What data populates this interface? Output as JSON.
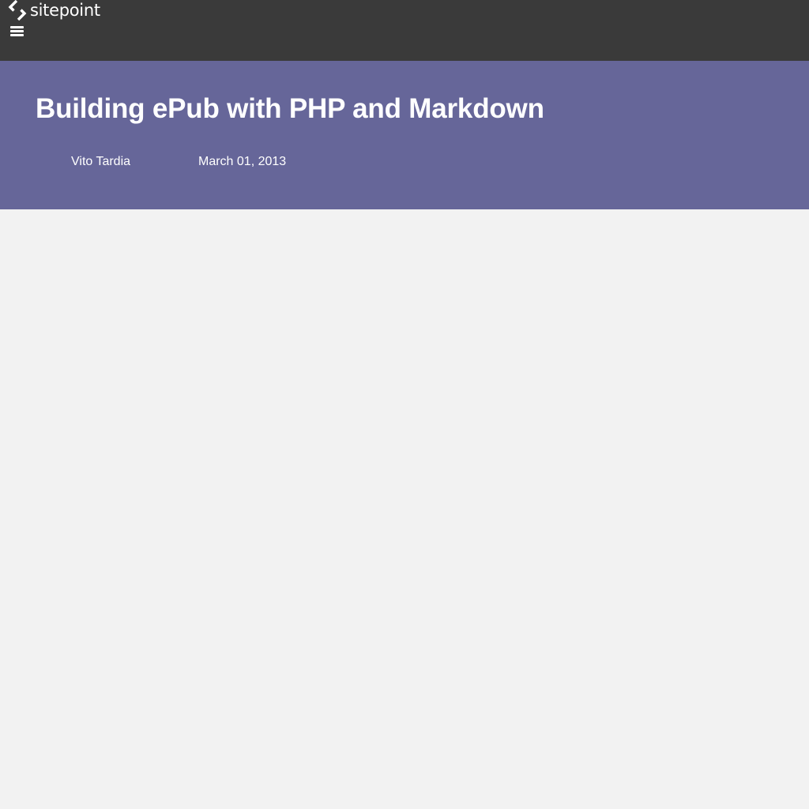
{
  "header": {
    "logo_text": "sitepoint",
    "logo_icon": "sitepoint-logo-icon",
    "menu_icon": "hamburger-menu-icon"
  },
  "article": {
    "title": "Building ePub with PHP and Markdown",
    "author": "Vito Tardia",
    "date": "March 01, 2013"
  },
  "colors": {
    "header_bg": "#3a3a3a",
    "hero_bg": "#666699",
    "page_bg": "#f2f2f2",
    "text_on_dark": "#ffffff"
  }
}
